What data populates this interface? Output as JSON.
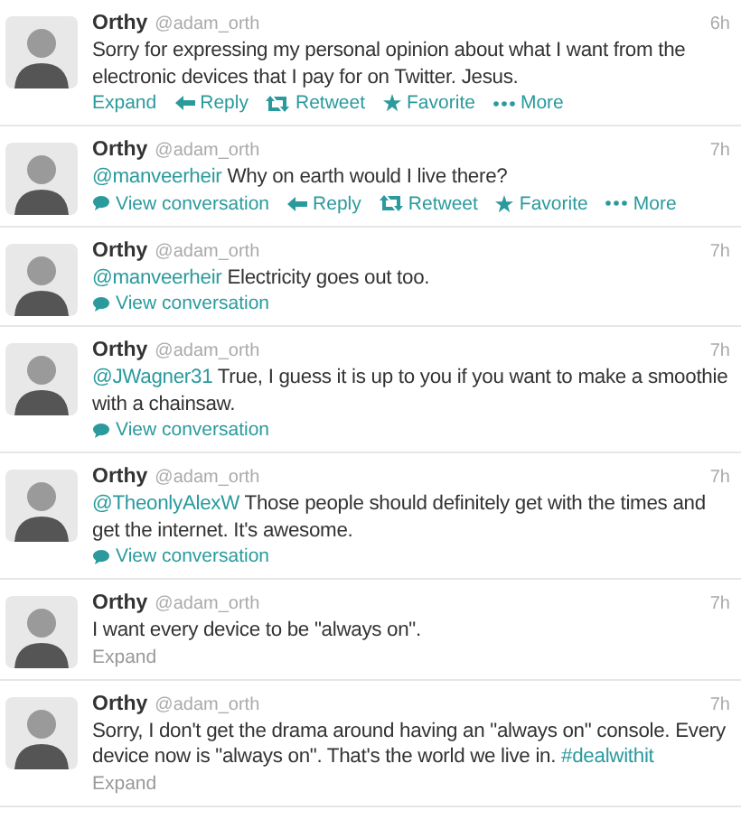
{
  "tweets": [
    {
      "name": "Orthy",
      "handle": "@adam_orth",
      "time": "6h",
      "segments": [
        {
          "kind": "plain",
          "text": "Sorry for expressing my personal opinion about what I want from the electronic devices that I pay for on Twitter. Jesus."
        }
      ],
      "actions": [
        {
          "kind": "expand",
          "label": "Expand",
          "highlighted": true
        },
        {
          "kind": "reply",
          "label": "Reply",
          "highlighted": true
        },
        {
          "kind": "retweet",
          "label": "Retweet",
          "highlighted": true
        },
        {
          "kind": "favorite",
          "label": "Favorite",
          "highlighted": true
        },
        {
          "kind": "more",
          "label": "More",
          "highlighted": true
        }
      ]
    },
    {
      "name": "Orthy",
      "handle": "@adam_orth",
      "time": "7h",
      "segments": [
        {
          "kind": "mention",
          "text": "@manveerheir"
        },
        {
          "kind": "plain",
          "text": " Why on earth would I live there?"
        }
      ],
      "actions": [
        {
          "kind": "conversation",
          "label": "View conversation",
          "highlighted": true
        },
        {
          "kind": "reply",
          "label": "Reply",
          "highlighted": true
        },
        {
          "kind": "retweet",
          "label": "Retweet",
          "highlighted": true
        },
        {
          "kind": "favorite",
          "label": "Favorite",
          "highlighted": true
        },
        {
          "kind": "more",
          "label": "More",
          "highlighted": true
        }
      ]
    },
    {
      "name": "Orthy",
      "handle": "@adam_orth",
      "time": "7h",
      "segments": [
        {
          "kind": "mention",
          "text": "@manveerheir"
        },
        {
          "kind": "plain",
          "text": " Electricity goes out too."
        }
      ],
      "actions": [
        {
          "kind": "conversation",
          "label": "View conversation",
          "highlighted": true
        }
      ]
    },
    {
      "name": "Orthy",
      "handle": "@adam_orth",
      "time": "7h",
      "segments": [
        {
          "kind": "mention",
          "text": "@JWagner31"
        },
        {
          "kind": "plain",
          "text": " True, I guess it is up to you if you want to make a smoothie with a chainsaw."
        }
      ],
      "actions": [
        {
          "kind": "conversation",
          "label": "View conversation",
          "highlighted": true
        }
      ]
    },
    {
      "name": "Orthy",
      "handle": "@adam_orth",
      "time": "7h",
      "segments": [
        {
          "kind": "mention",
          "text": "@TheonlyAlexW"
        },
        {
          "kind": "plain",
          "text": " Those people should definitely get with the times and get the internet. It's awesome."
        }
      ],
      "actions": [
        {
          "kind": "conversation",
          "label": "View conversation",
          "highlighted": true
        }
      ]
    },
    {
      "name": "Orthy",
      "handle": "@adam_orth",
      "time": "7h",
      "segments": [
        {
          "kind": "plain",
          "text": "I want every device to be \"always on\"."
        }
      ],
      "actions": [
        {
          "kind": "expand",
          "label": "Expand",
          "highlighted": false
        }
      ]
    },
    {
      "name": "Orthy",
      "handle": "@adam_orth",
      "time": "7h",
      "segments": [
        {
          "kind": "plain",
          "text": "Sorry, I don't get the drama around having an \"always on\" console. Every device now is \"always on\". That's the world we live in. "
        },
        {
          "kind": "hashtag",
          "text": "#dealwithit"
        }
      ],
      "actions": [
        {
          "kind": "expand",
          "label": "Expand",
          "highlighted": false
        }
      ]
    }
  ]
}
